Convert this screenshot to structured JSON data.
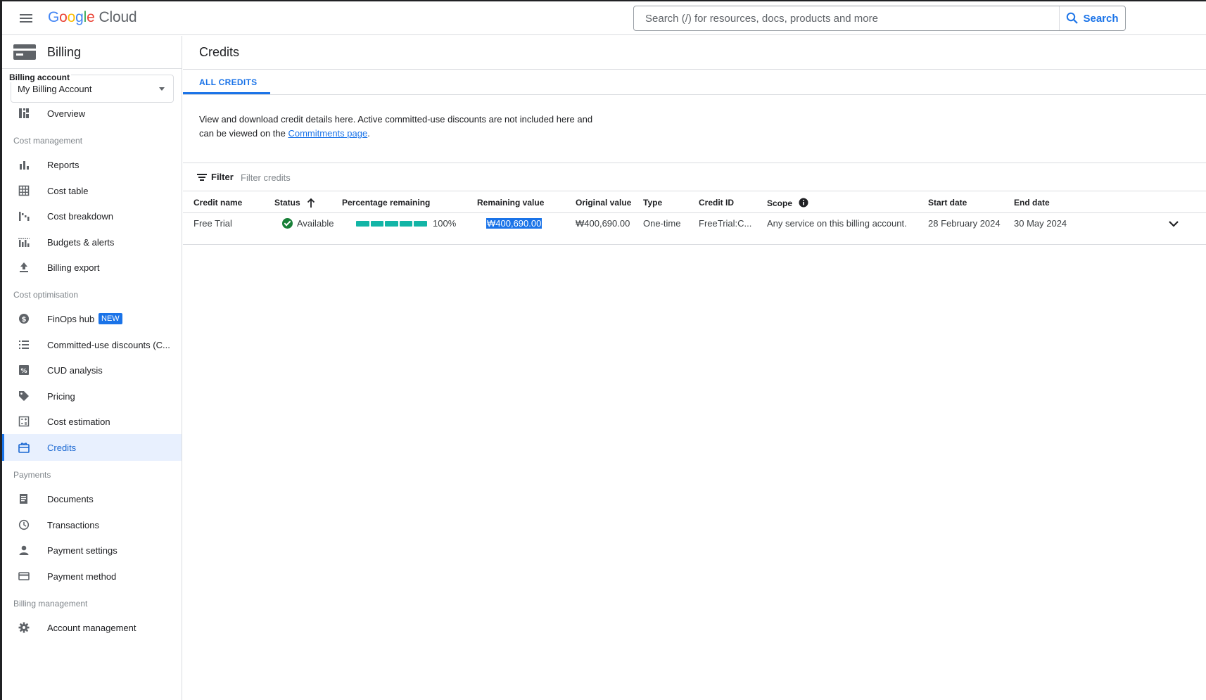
{
  "header": {
    "logo_google": [
      "G",
      "o",
      "o",
      "g",
      "l",
      "e"
    ],
    "logo_cloud": "Cloud",
    "search_placeholder": "Search (/) for resources, docs, products and more",
    "search_button": "Search"
  },
  "sidebar": {
    "product_title": "Billing",
    "billing_account_label": "Billing account",
    "billing_account_value": "My Billing Account",
    "overview": "Overview",
    "sections": {
      "cost_management": "Cost management",
      "cost_optimisation": "Cost optimisation",
      "payments": "Payments",
      "billing_management": "Billing management"
    },
    "items": {
      "reports": "Reports",
      "cost_table": "Cost table",
      "cost_breakdown": "Cost breakdown",
      "budgets_alerts": "Budgets & alerts",
      "billing_export": "Billing export",
      "finops_hub": "FinOps hub",
      "finops_badge": "NEW",
      "committed_use": "Committed-use discounts (C...",
      "cud_analysis": "CUD analysis",
      "pricing": "Pricing",
      "cost_estimation": "Cost estimation",
      "credits": "Credits",
      "documents": "Documents",
      "transactions": "Transactions",
      "payment_settings": "Payment settings",
      "payment_method": "Payment method",
      "account_management": "Account management"
    }
  },
  "main": {
    "title": "Credits",
    "tab": "ALL CREDITS",
    "desc_text": "View and download credit details here. Active committed-use discounts are not included here and can be viewed on the ",
    "desc_link": "Commitments page",
    "desc_end": ".",
    "filter_label": "Filter",
    "filter_placeholder": "Filter credits",
    "columns": {
      "credit_name": "Credit name",
      "status": "Status",
      "percentage_remaining": "Percentage remaining",
      "remaining_value": "Remaining value",
      "original_value": "Original value",
      "type": "Type",
      "credit_id": "Credit ID",
      "scope": "Scope",
      "start_date": "Start date",
      "end_date": "End date"
    },
    "row": {
      "credit_name": "Free Trial",
      "status": "Available",
      "percentage_remaining": "100%",
      "percentage_value": 1.0,
      "remaining_value": "₩400,690.00",
      "original_value": "₩400,690.00",
      "type": "One-time",
      "credit_id": "FreeTrial:C...",
      "scope": "Any service on this billing account.",
      "start_date": "28 February 2024",
      "end_date": "30 May 2024"
    }
  },
  "colors": {
    "accent": "#1a73e8",
    "progress": "#12b5a6",
    "status_ok": "#188038"
  }
}
